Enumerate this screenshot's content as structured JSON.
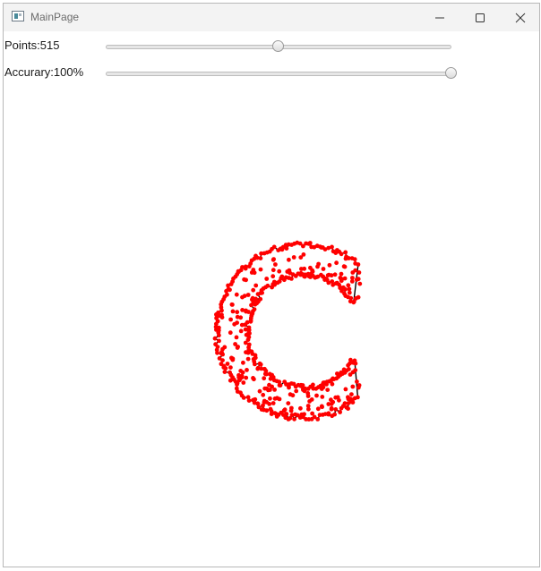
{
  "window": {
    "title": "MainPage",
    "icons": {
      "app": "app-window-icon",
      "minimize": "minimize-icon",
      "maximize": "maximize-icon",
      "close": "close-icon"
    }
  },
  "controls": {
    "points": {
      "label": "Points:515",
      "value": 515,
      "fraction": 0.5
    },
    "accuracy": {
      "label": "Accurary:100%",
      "value": 100,
      "fraction": 1.0
    }
  },
  "drawing": {
    "point_color": "#ff0000",
    "line_color": "#000000",
    "point_count": 515
  }
}
